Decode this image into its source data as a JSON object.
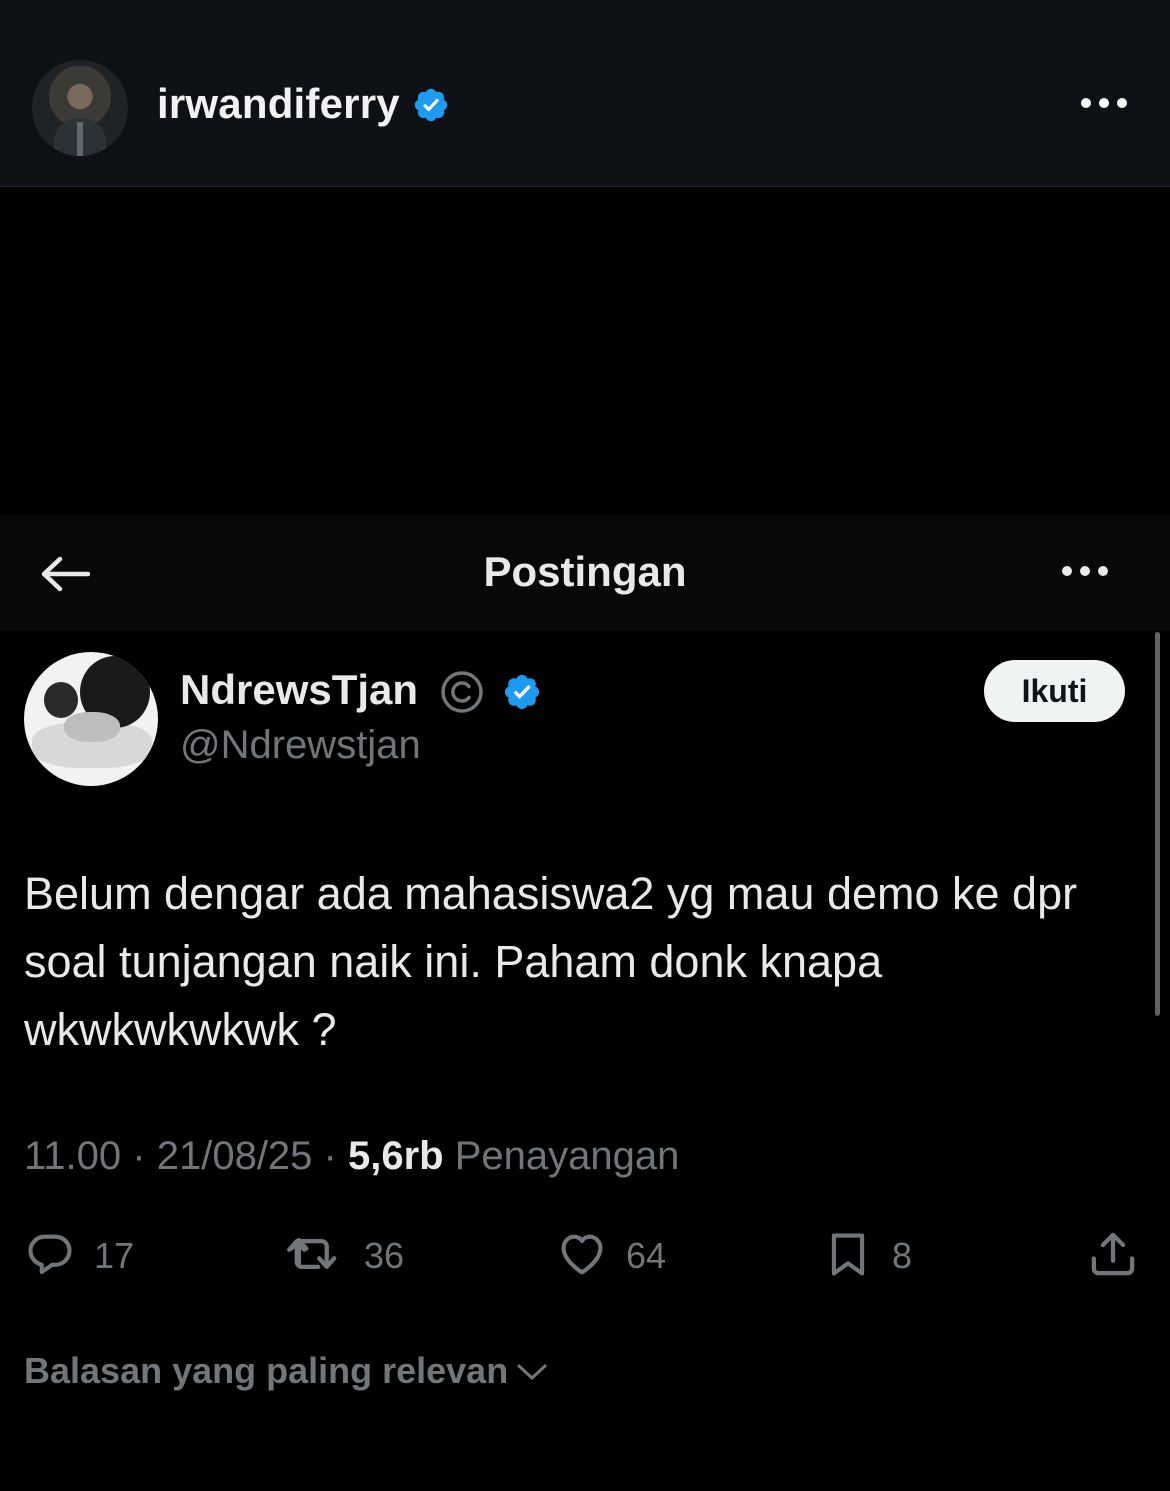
{
  "top_bar": {
    "username": "irwandiferry",
    "verified": true
  },
  "nav": {
    "title": "Postingan"
  },
  "post": {
    "author_name": "NdrewsTjan",
    "author_handle": "@Ndrewstjan",
    "verified": true,
    "follow_label": "Ikuti",
    "text": "Belum dengar ada mahasiswa2 yg mau demo ke dpr soal tunjangan naik ini. Paham donk knapa wkwkwkwkwk ?",
    "time": "11.00",
    "date": "21/08/25",
    "views_count": "5,6rb",
    "views_label": "Penayangan",
    "separator": "·"
  },
  "actions": {
    "replies": "17",
    "reposts": "36",
    "likes": "64",
    "bookmarks": "8"
  },
  "replies_sort": {
    "label": "Balasan yang paling relevan"
  },
  "icons": {
    "verified_badge": "verified-badge-icon",
    "copyright": "copyright-icon",
    "more": "more-horizontal-icon",
    "back": "back-arrow-icon",
    "reply": "reply-bubble-icon",
    "repost": "repost-icon",
    "like": "heart-icon",
    "bookmark": "bookmark-icon",
    "share": "share-icon",
    "chevron": "chevron-down-icon"
  },
  "colors": {
    "background": "#000000",
    "top_bar": "#0e1217",
    "verified_blue": "#1d9bf0",
    "text_primary": "#e7e9ea",
    "text_secondary": "#71767b",
    "follow_button_bg": "#eff3f4"
  }
}
